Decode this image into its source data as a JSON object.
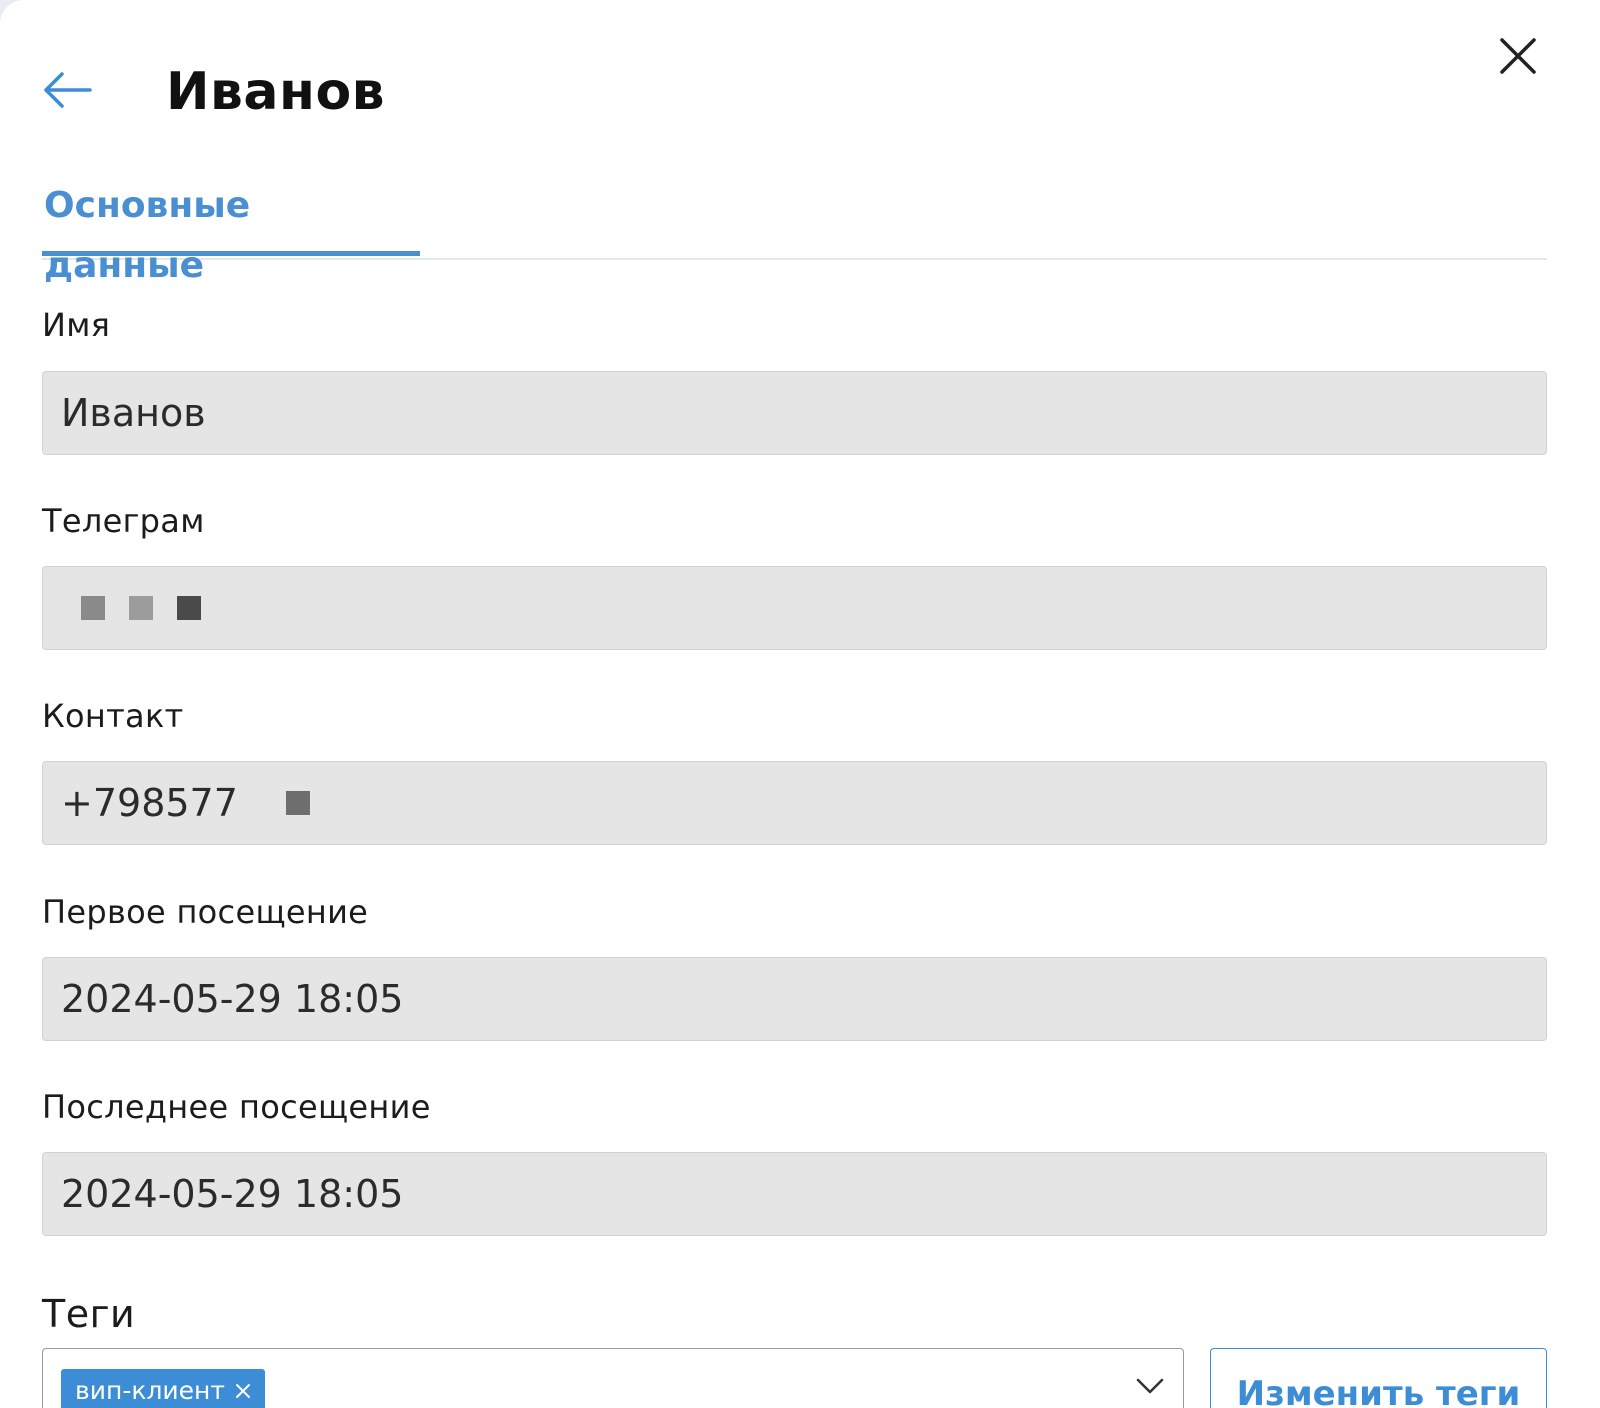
{
  "header": {
    "title": "Иванов",
    "back_icon": "arrow-left-icon",
    "close_icon": "close-icon"
  },
  "tabs": [
    {
      "label": "Основные данные",
      "active": true
    }
  ],
  "fields": {
    "name": {
      "label": "Имя",
      "value": "Иванов"
    },
    "telegram": {
      "label": "Телеграм",
      "value": ""
    },
    "contact": {
      "label": "Контакт",
      "value": "+798577"
    },
    "first_visit": {
      "label": "Первое посещение",
      "value": "2024-05-29 18:05"
    },
    "last_visit": {
      "label": "Последнее посещение",
      "value": "2024-05-29 18:05"
    }
  },
  "tags": {
    "label": "Теги",
    "selected": [
      "вип-клиент"
    ],
    "edit_button_label": "Изменить теги"
  },
  "colors": {
    "accent": "#3c8dd6",
    "field_background": "#e5e5e5"
  }
}
